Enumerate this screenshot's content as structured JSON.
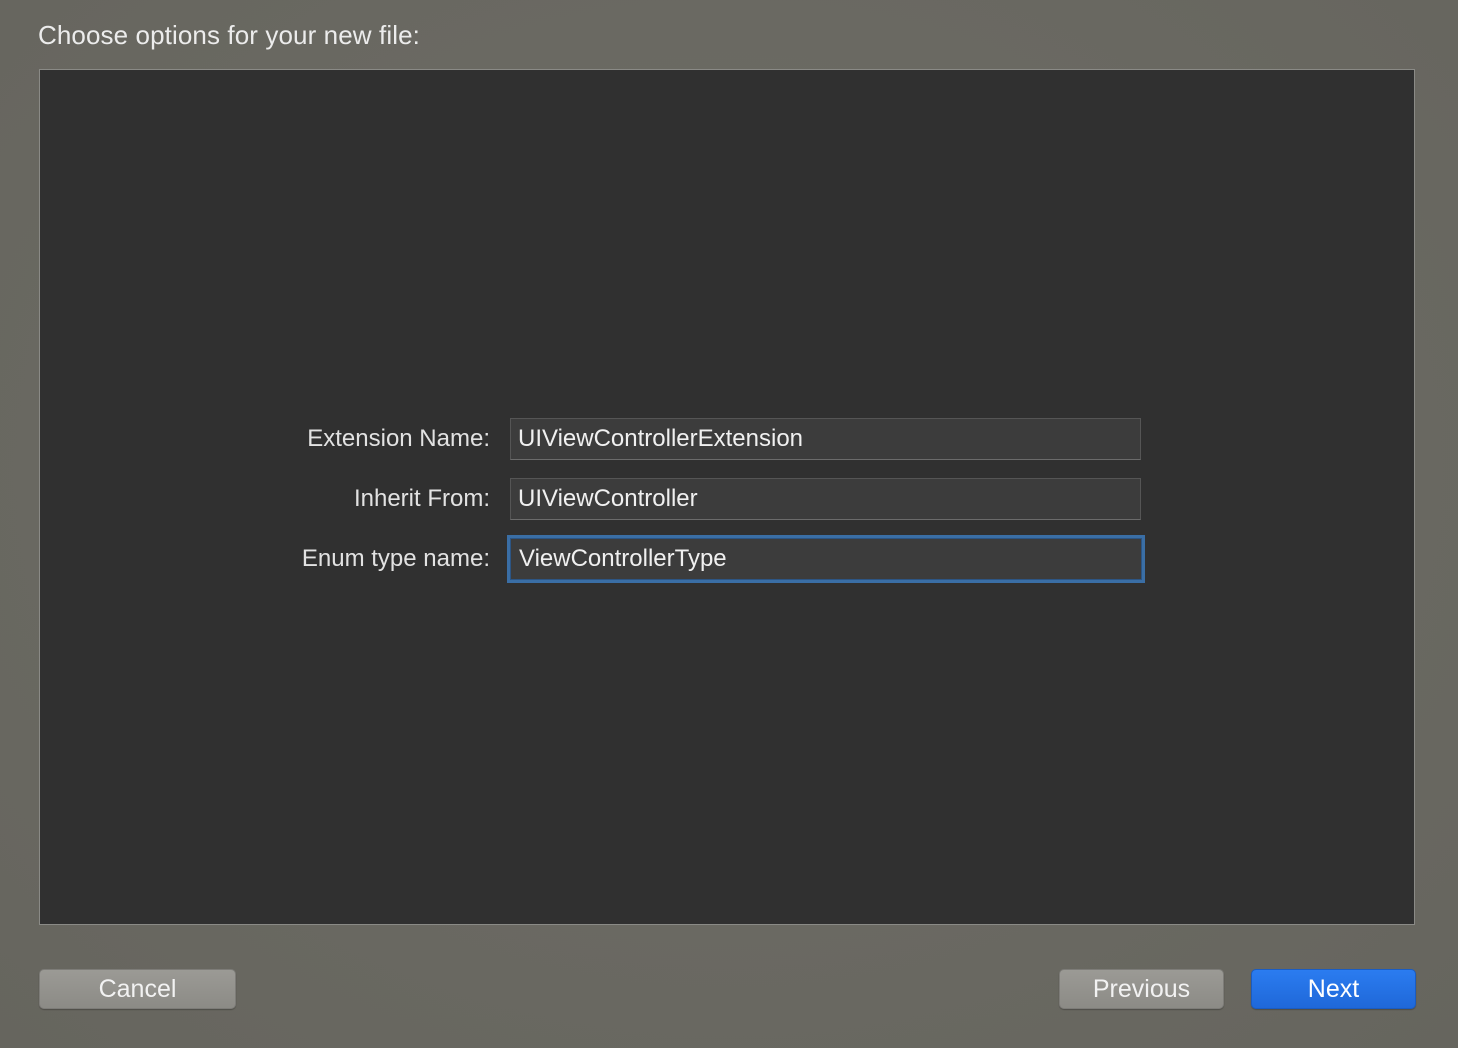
{
  "dialog": {
    "heading": "Choose options for your new file:"
  },
  "form": {
    "fields": [
      {
        "label": "Extension Name:",
        "value": "UIViewControllerExtension"
      },
      {
        "label": "Inherit From:",
        "value": "UIViewController"
      },
      {
        "label": "Enum type name:",
        "value": "ViewControllerType"
      }
    ]
  },
  "buttons": {
    "cancel": "Cancel",
    "previous": "Previous",
    "next": "Next"
  },
  "colors": {
    "accent": "#1f68d9",
    "focus_ring": "#3a6ea5",
    "panel_background": "#303030"
  }
}
